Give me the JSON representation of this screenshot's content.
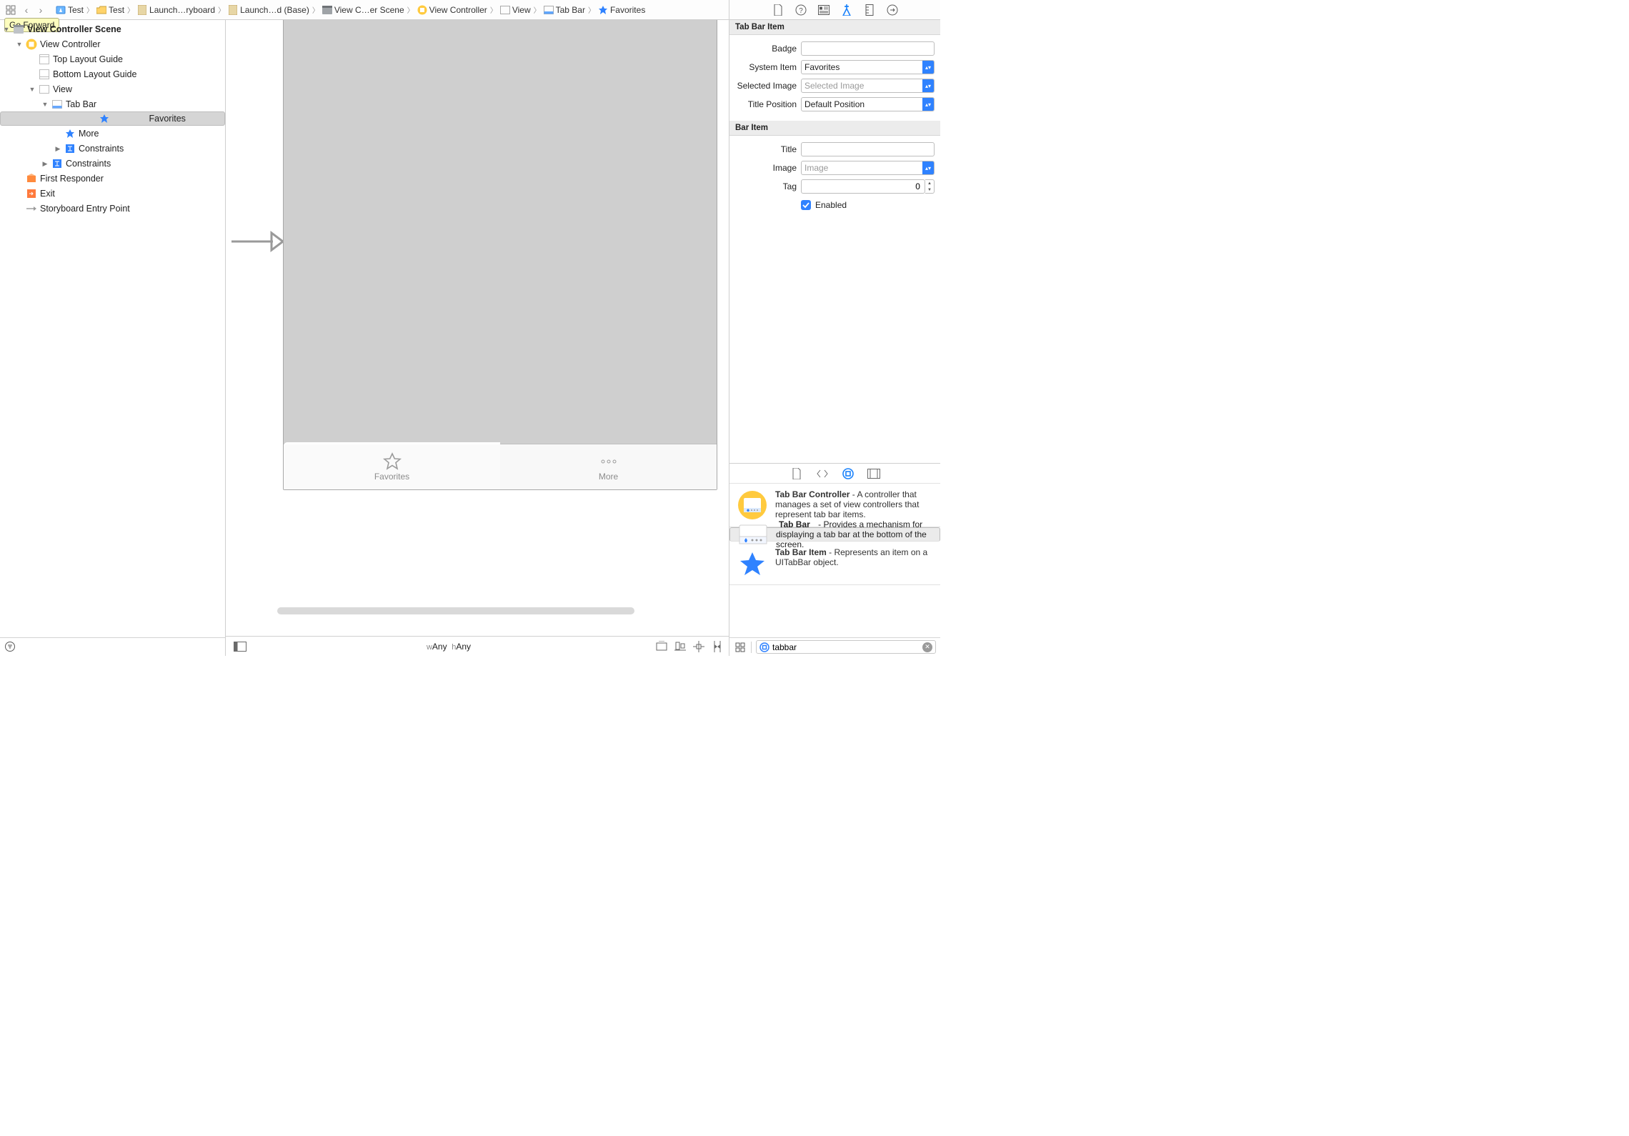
{
  "tooltip": "Go Forward",
  "breadcrumbs": [
    {
      "label": "Test",
      "icon": "project-blue"
    },
    {
      "label": "Test",
      "icon": "folder-yellow"
    },
    {
      "label": "Launch…ryboard",
      "icon": "storyboard"
    },
    {
      "label": "Launch…d (Base)",
      "icon": "storyboard"
    },
    {
      "label": "View C…er Scene",
      "icon": "scene"
    },
    {
      "label": "View Controller",
      "icon": "vc-yellow"
    },
    {
      "label": "View",
      "icon": "view"
    },
    {
      "label": "Tab Bar",
      "icon": "tabbar"
    },
    {
      "label": "Favorites",
      "icon": "star-blue"
    }
  ],
  "outline": {
    "root": "View Controller Scene",
    "vc": "View Controller",
    "top_guide": "Top Layout Guide",
    "bot_guide": "Bottom Layout Guide",
    "view": "View",
    "tabbar": "Tab Bar",
    "favorites": "Favorites",
    "more": "More",
    "constraints1": "Constraints",
    "constraints2": "Constraints",
    "first_responder": "First Responder",
    "exit": "Exit",
    "entry_point": "Storyboard Entry Point"
  },
  "canvas": {
    "tabs": {
      "favorites": "Favorites",
      "more": "More"
    },
    "size_w_label": "w",
    "size_w": "Any",
    "size_h_label": "h",
    "size_h": "Any"
  },
  "inspector": {
    "tabbar_item": {
      "title": "Tab Bar Item",
      "badge_label": "Badge",
      "badge_value": "",
      "system_item_label": "System Item",
      "system_item_value": "Favorites",
      "selected_image_label": "Selected Image",
      "selected_image_placeholder": "Selected Image",
      "title_position_label": "Title Position",
      "title_position_value": "Default Position"
    },
    "bar_item": {
      "title": "Bar Item",
      "title_label": "Title",
      "title_value": "",
      "image_label": "Image",
      "image_placeholder": "Image",
      "tag_label": "Tag",
      "tag_value": "0",
      "enabled_label": "Enabled"
    }
  },
  "library": {
    "items": [
      {
        "title": "Tab Bar Controller",
        "desc": " - A controller that manages a set of view controllers that represent tab bar items.",
        "thumb": "tbc"
      },
      {
        "title": "Tab Bar",
        "desc": " - Provides a mechanism for displaying a tab bar at the bottom of the screen.",
        "thumb": "tb"
      },
      {
        "title": "Tab Bar Item",
        "desc": " - Represents an item on a UITabBar object.",
        "thumb": "tbi"
      }
    ],
    "search": "tabbar"
  }
}
